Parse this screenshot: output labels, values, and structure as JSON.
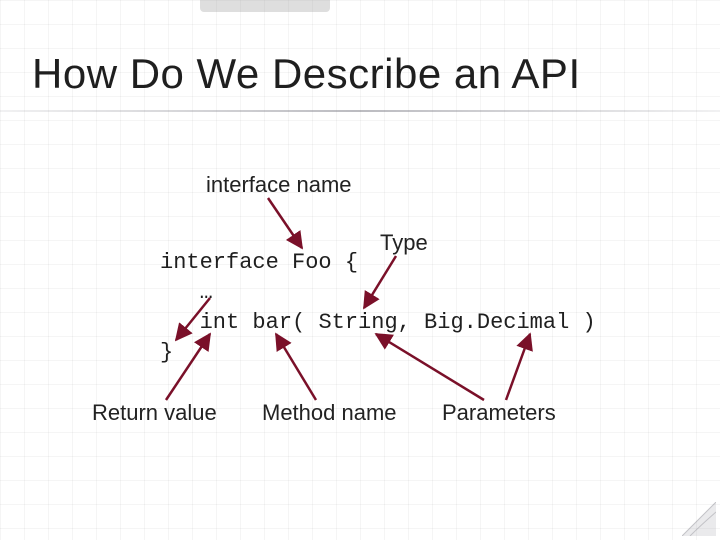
{
  "title": "How Do We Describe an API",
  "labels": {
    "interface_name": "interface name",
    "type": "Type",
    "return_value": "Return value",
    "method_name": "Method name",
    "parameters": "Parameters"
  },
  "code": {
    "line1_kw": "interface",
    "line1_rest": " Foo {",
    "line2": "   …",
    "line3_indent": "   ",
    "line3_type": "int",
    "line3_rest1": " bar( ",
    "line3_param1": "String",
    "line3_rest2": ", Big.",
    "line3_param2": "Decimal",
    "line3_rest3": " )",
    "line4": "}"
  },
  "colors": {
    "arrow": "#7a1029"
  }
}
